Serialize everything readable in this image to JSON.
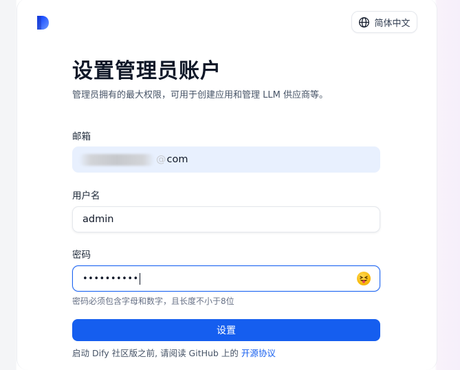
{
  "header": {
    "logo_icon": "dify-logo-icon",
    "language_label": "简体中文",
    "language_icon": "globe-icon"
  },
  "main": {
    "title": "设置管理员账户",
    "subtitle": "管理员拥有的最大权限，可用于创建应用和管理 LLM 供应商等。"
  },
  "form": {
    "email_label": "邮箱",
    "email_value_visible": "com",
    "email_value_partial": "@",
    "username_label": "用户名",
    "username_value": "admin",
    "password_label": "密码",
    "password_masked": "••••••••••",
    "password_hint": "密码必须包含字母和数字，且长度不小于8位",
    "submit_label": "设置"
  },
  "footer": {
    "prefix": "启动 Dify 社区版之前, 请阅读 GitHub 上的",
    "link_label": "开源协议"
  },
  "colors": {
    "primary": "#155eef",
    "email_bg": "#e8f0fe",
    "focus_border": "#1c64f2"
  }
}
